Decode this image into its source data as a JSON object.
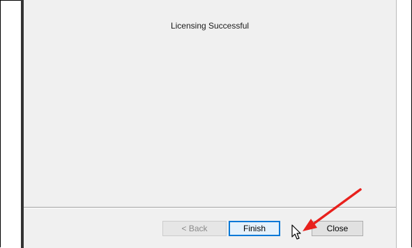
{
  "dialog": {
    "title": "Licensing Successful"
  },
  "buttons": {
    "back_label": "< Back",
    "finish_label": "Finish",
    "close_label": "Close"
  },
  "icons": {
    "cursor": "mouse-pointer-icon",
    "annotation": "red-arrow-icon"
  },
  "colors": {
    "annotation": "#e8211d",
    "focus_border": "#0078d7"
  }
}
